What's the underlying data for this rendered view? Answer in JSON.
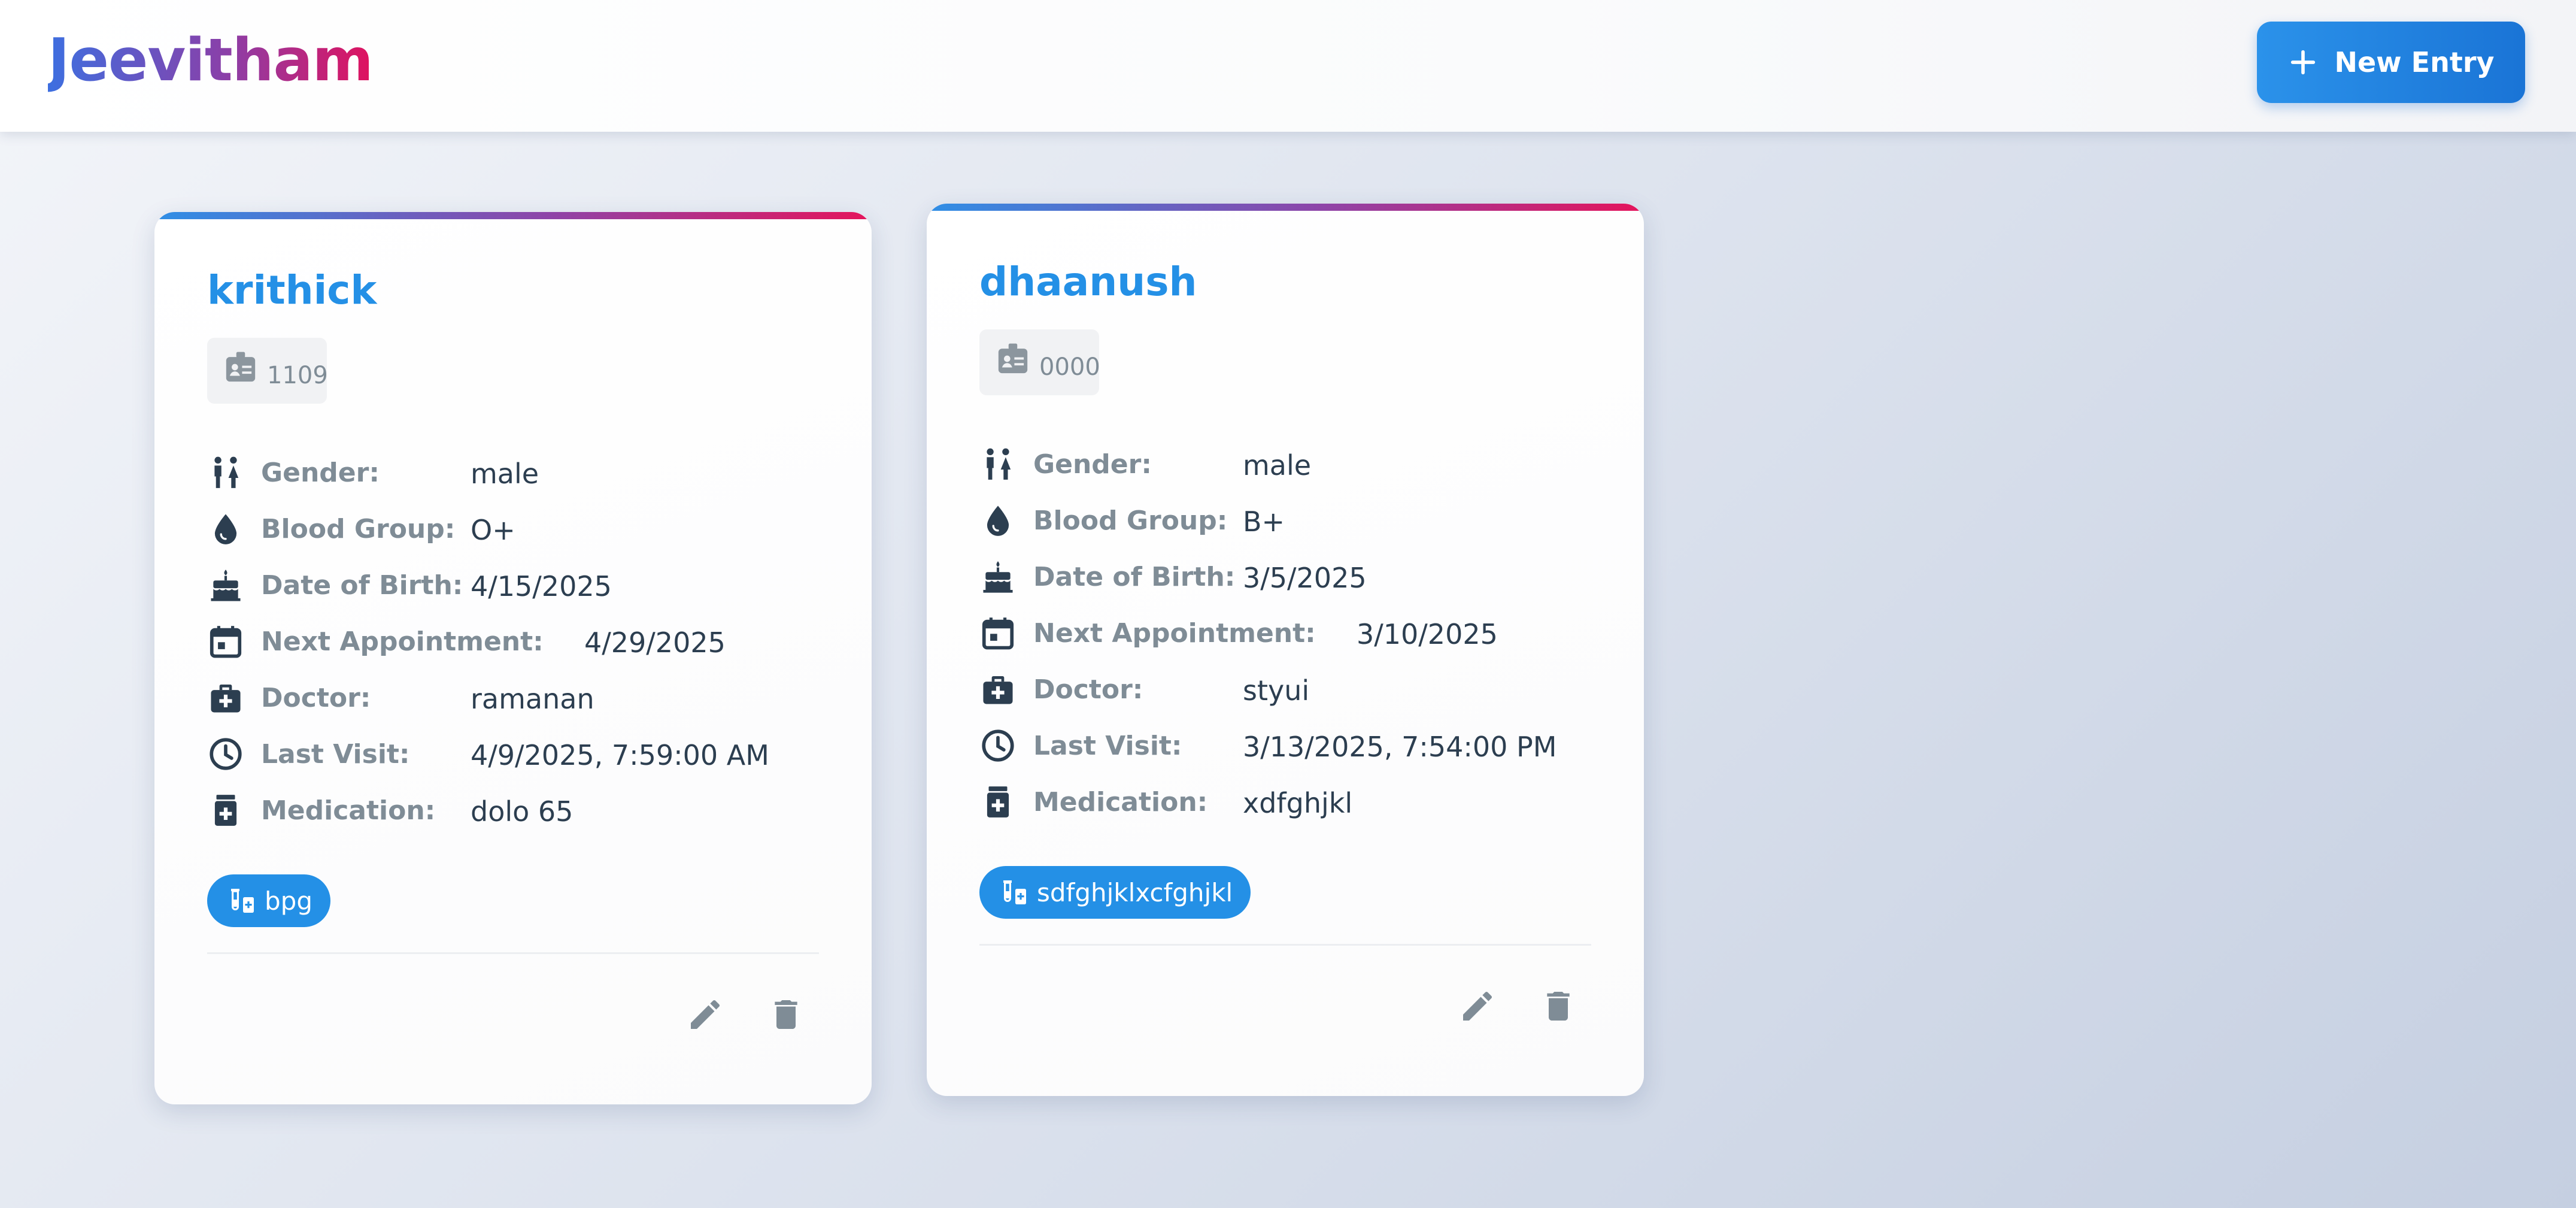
{
  "app": {
    "title": "Jeevitham",
    "new_entry_label": "New Entry"
  },
  "labels": {
    "gender": "Gender:",
    "blood_group": "Blood Group:",
    "dob": "Date of Birth:",
    "next_appointment": "Next Appointment:",
    "doctor": "Doctor:",
    "last_visit": "Last Visit:",
    "medication": "Medication:"
  },
  "colors": {
    "accent": "#2490e6",
    "brand_gradient_start": "#3d6fe0",
    "brand_gradient_end": "#e0125e",
    "label_gray": "#7f8c96",
    "icon_dark": "#2c3e50"
  },
  "cards": [
    {
      "name": "krithick",
      "id": "1109",
      "gender": "male",
      "blood_group": "O+",
      "dob": "4/15/2025",
      "next_appointment": "4/29/2025",
      "doctor": "ramanan",
      "last_visit": "4/9/2025, 7:59:00 AM",
      "medication": "dolo 65",
      "tag": "bpg"
    },
    {
      "name": "dhaanush",
      "id": "0000",
      "gender": "male",
      "blood_group": "B+",
      "dob": "3/5/2025",
      "next_appointment": "3/10/2025",
      "doctor": "styui",
      "last_visit": "3/13/2025, 7:54:00 PM",
      "medication": "xdfghjkl",
      "tag": "sdfghjklxcfghjkl"
    }
  ]
}
